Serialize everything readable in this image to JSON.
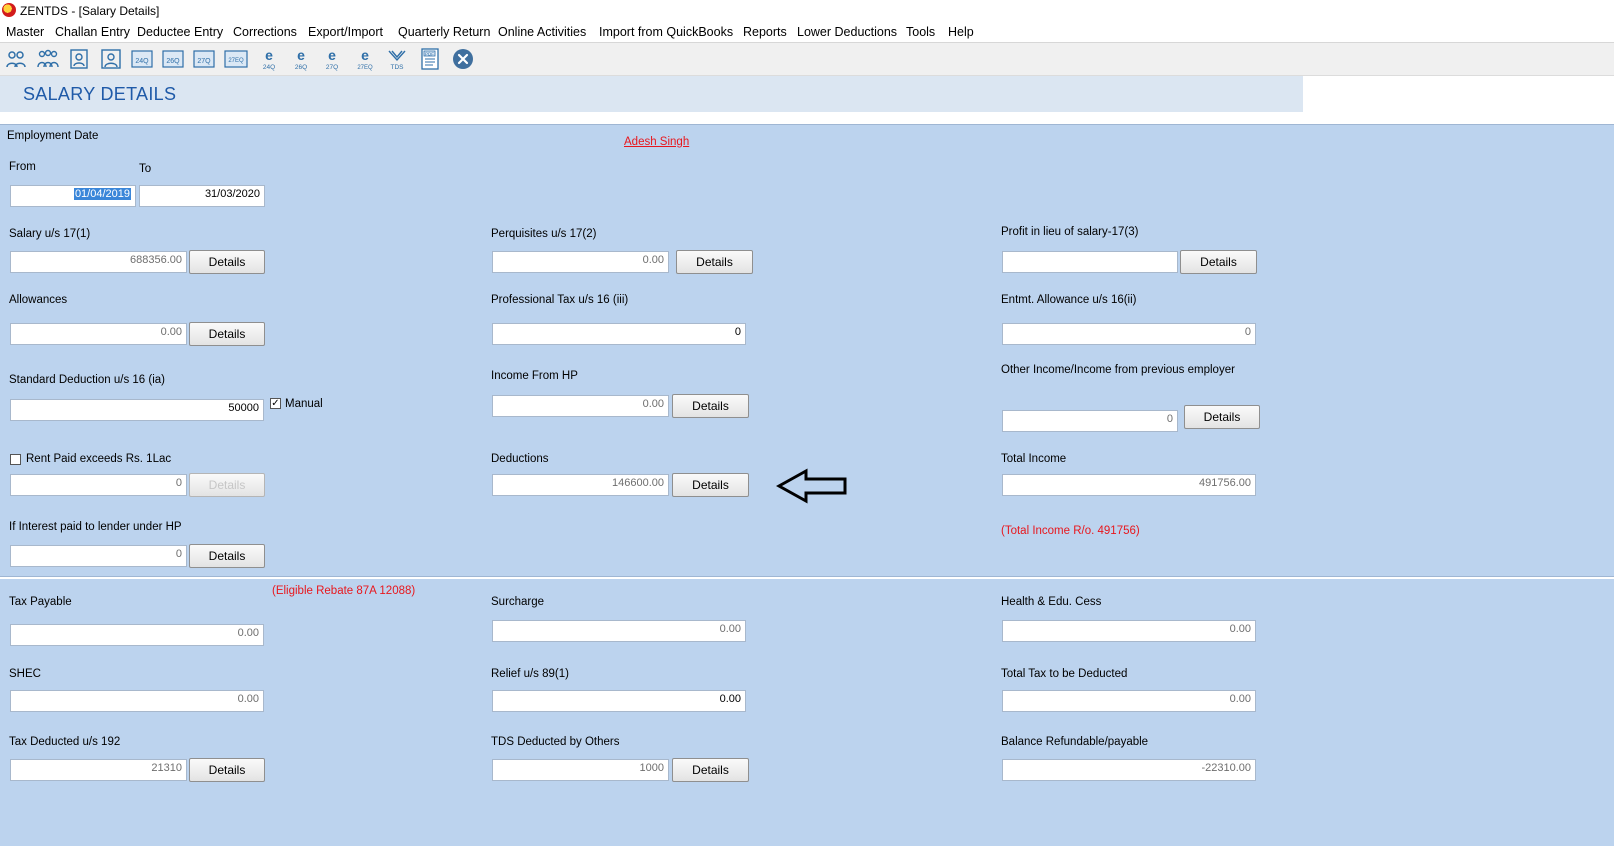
{
  "window": {
    "title": "ZENTDS - [Salary Details]"
  },
  "menu": [
    "Master",
    "Challan Entry",
    "Deductee Entry",
    "Corrections",
    "Export/Import",
    "Quarterly Return",
    "Online Activities",
    "Import from QuickBooks",
    "Reports",
    "Lower Deductions",
    "Tools",
    "Help"
  ],
  "toolbar": {
    "icons": [
      "users-icon",
      "group-icon",
      "deductee-icon",
      "deductee-2-icon",
      "form-24q-icon",
      "form-26q-icon",
      "form-27q-icon",
      "form-27eq-icon",
      "efile-24q-icon",
      "efile-26q-icon",
      "efile-27q-icon",
      "efile-27eq-icon",
      "tds-icon",
      "pdf-icon",
      "close-icon"
    ],
    "labels": {
      "form_24q": "24Q",
      "form_26q": "26Q",
      "form_27q": "27Q",
      "form_27eq": "27EQ",
      "e": "e",
      "tds": "TDS",
      "pdf": "PDF"
    }
  },
  "header": {
    "title": "SALARY DETAILS"
  },
  "employee": {
    "name": "Adesh Singh"
  },
  "employment": {
    "label": "Employment Date",
    "from_label": "From",
    "to_label": "To",
    "from": "01/04/2019",
    "to": "31/03/2020"
  },
  "details_label": "Details",
  "fields": {
    "salary": {
      "label": "Salary u/s 17(1)",
      "value": "688356.00"
    },
    "perquisites": {
      "label": "Perquisites u/s 17(2)",
      "value": "0.00"
    },
    "profit": {
      "label": "Profit in lieu of salary-17(3)",
      "value": ""
    },
    "allowances": {
      "label": "Allowances",
      "value": "0.00"
    },
    "prof_tax": {
      "label": "Professional Tax u/s 16 (iii)",
      "value": "0"
    },
    "entmt": {
      "label": "Entmt. Allowance u/s 16(ii)",
      "value": "0"
    },
    "std_ded": {
      "label": "Standard Deduction u/s 16 (ia)",
      "value": "50000",
      "manual_label": "Manual",
      "manual_checked": "✓"
    },
    "income_hp": {
      "label": "Income From HP",
      "value": "0.00"
    },
    "other_income": {
      "label": "Other Income/Income from previous employer",
      "value": "0"
    },
    "rent": {
      "label": "Rent Paid exceeds Rs. 1Lac",
      "value": "0"
    },
    "deductions": {
      "label": "Deductions",
      "value": "146600.00"
    },
    "total_income": {
      "label": "Total Income",
      "value": "491756.00",
      "ro_note": "(Total Income R/o. 491756)"
    },
    "interest": {
      "label": "If Interest paid to lender under HP",
      "value": "0"
    },
    "tax_payable": {
      "label": "Tax Payable",
      "value": "0.00",
      "rebate_note": "(Eligible Rebate 87A 12088)"
    },
    "surcharge": {
      "label": "Surcharge",
      "value": "0.00"
    },
    "cess": {
      "label": "Health & Edu. Cess",
      "value": "0.00"
    },
    "shec": {
      "label": "SHEC",
      "value": "0.00"
    },
    "relief": {
      "label": "Relief u/s 89(1)",
      "value": "0.00"
    },
    "total_tax": {
      "label": "Total Tax to be Deducted",
      "value": "0.00"
    },
    "tax_deducted": {
      "label": "Tax Deducted u/s 192",
      "value": "21310"
    },
    "tds_others": {
      "label": "TDS Deducted by Others",
      "value": "1000"
    },
    "balance": {
      "label": "Balance Refundable/payable",
      "value": "-22310.00"
    }
  }
}
